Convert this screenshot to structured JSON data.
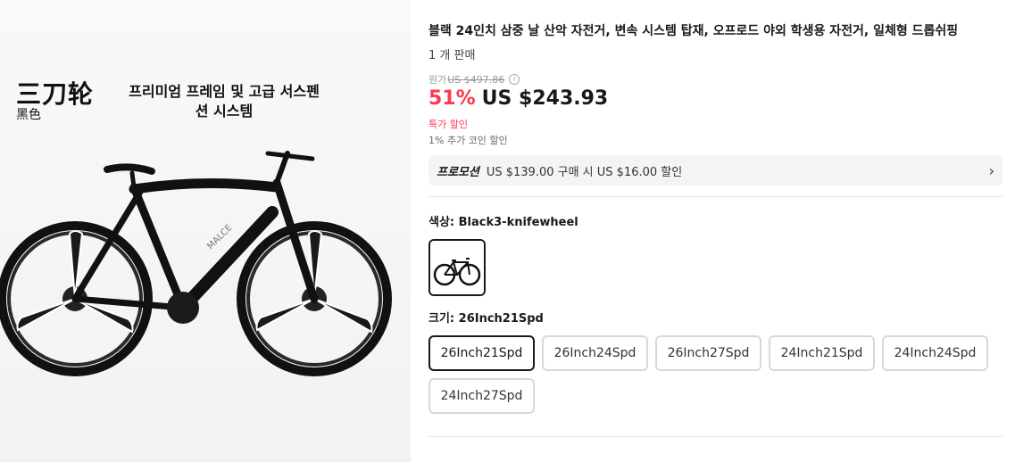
{
  "image": {
    "overlay_cn": "三刀轮",
    "overlay_cn_sub": "黑色",
    "overlay_ko_line1": "프리미엄 프레임 및 고급 서스펜",
    "overlay_ko_line2": "션 시스템",
    "frame_brand": "MALCE"
  },
  "product": {
    "title": "블랙 24인치 삼중 날 산악 자전거, 변속 시스템 탑재, 오프로드 야외 학생용 자전거, 일체형 드롭쉬핑",
    "sold": "1 개 판매",
    "original_label": "원가",
    "original_price": "US $497.86",
    "info_icon": "i",
    "discount": "51%",
    "price": "US $243.93",
    "special": "특가 할인",
    "coin": "1% 추가 코인 할인"
  },
  "promo": {
    "tag": "프로모션",
    "text": "US $139.00 구매 시 US $16.00 할인",
    "chevron": "›"
  },
  "color": {
    "label": "색상: Black3-knifewheel"
  },
  "size": {
    "label": "크기: 26Inch21Spd",
    "options": [
      "26Inch21Spd",
      "26Inch24Spd",
      "26Inch27Spd",
      "24Inch21Spd",
      "24Inch24Spd",
      "24Inch27Spd"
    ],
    "selected_index": 0
  },
  "colors": {
    "accent": "#fd384f",
    "text": "#191919"
  }
}
